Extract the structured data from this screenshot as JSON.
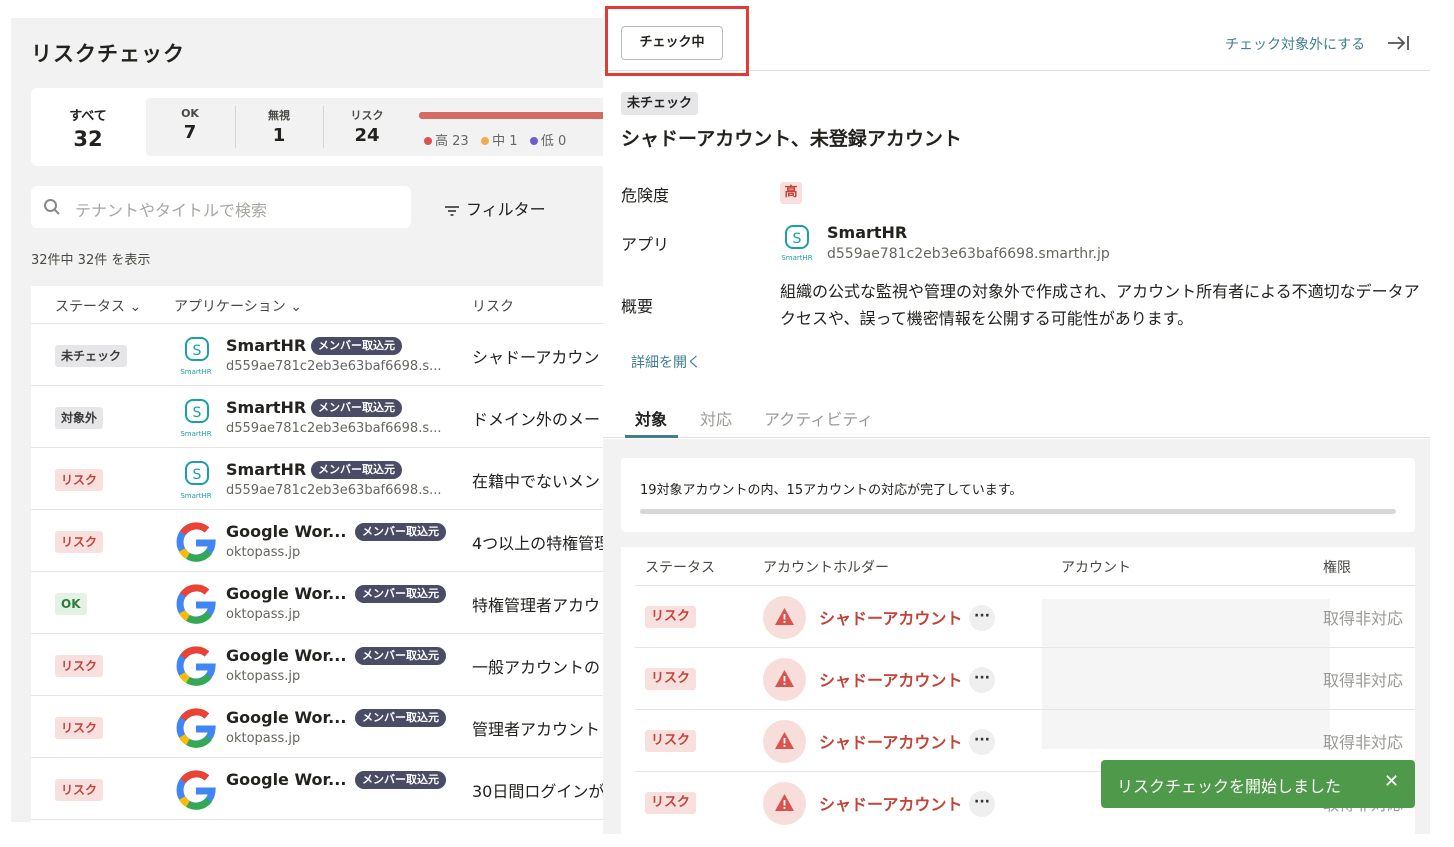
{
  "left": {
    "title": "リスクチェック",
    "summary": {
      "all": {
        "label": "すべて",
        "value": "32"
      },
      "ok": {
        "label": "OK",
        "value": "7"
      },
      "ignore": {
        "label": "無視",
        "value": "1"
      },
      "risk": {
        "label": "リスク",
        "value": "24"
      },
      "levels": [
        {
          "label": "高 23",
          "color": "#d9534f"
        },
        {
          "label": "中 1",
          "color": "#f0ad4e"
        },
        {
          "label": "低 0",
          "color": "#6f5bd3"
        }
      ]
    },
    "search_placeholder": "テナントやタイトルで検索",
    "filter_label": "フィルター",
    "count_text": "32件中 32件 を表示",
    "columns": {
      "status": "ステータス",
      "application": "アプリケーション",
      "risk": "リスク"
    },
    "rows": [
      {
        "status": "未チェック",
        "kind": "gray",
        "app": "SmartHR",
        "icon": "smarthr-icon",
        "tag": "メンバー取込元",
        "sub": "d559ae781c2eb3e63baf6698.s...",
        "risk": "シャドーアカウン"
      },
      {
        "status": "対象外",
        "kind": "gray",
        "app": "SmartHR",
        "icon": "smarthr-icon",
        "tag": "メンバー取込元",
        "sub": "d559ae781c2eb3e63baf6698.s...",
        "risk": "ドメイン外のメー"
      },
      {
        "status": "リスク",
        "kind": "red",
        "app": "SmartHR",
        "icon": "smarthr-icon",
        "tag": "メンバー取込元",
        "sub": "d559ae781c2eb3e63baf6698.s...",
        "risk": "在籍中でないメン"
      },
      {
        "status": "リスク",
        "kind": "red",
        "app": "Google Wor...",
        "icon": "google-icon",
        "tag": "メンバー取込元",
        "sub": "oktopass.jp",
        "risk": "4つ以上の特権管理"
      },
      {
        "status": "OK",
        "kind": "green",
        "app": "Google Wor...",
        "icon": "google-icon",
        "tag": "メンバー取込元",
        "sub": "oktopass.jp",
        "risk": "特権管理者アカウ"
      },
      {
        "status": "リスク",
        "kind": "red",
        "app": "Google Wor...",
        "icon": "google-icon",
        "tag": "メンバー取込元",
        "sub": "oktopass.jp",
        "risk": "一般アカウントの"
      },
      {
        "status": "リスク",
        "kind": "red",
        "app": "Google Wor...",
        "icon": "google-icon",
        "tag": "メンバー取込元",
        "sub": "oktopass.jp",
        "risk": "管理者アカウント"
      },
      {
        "status": "リスク",
        "kind": "red",
        "app": "Google Wor...",
        "icon": "google-icon",
        "tag": "メンバー取込元",
        "sub": "",
        "risk": "30日間ログインが"
      }
    ]
  },
  "detail": {
    "check_button": "チェック中",
    "exclude_link": "チェック対象外にする",
    "status_tag": "未チェック",
    "title": "シャドーアカウント、未登録アカウント",
    "severity_label": "危険度",
    "severity_value": "高",
    "app_label": "アプリ",
    "app_name": "SmartHR",
    "app_domain": "d559ae781c2eb3e63baf6698.smarthr.jp",
    "overview_label": "概要",
    "overview_text": "組織の公式な監視や管理の対象外で作成され、アカウント所有者による不適切なデータアクセスや、誤って機密情報を公開する可能性があります。",
    "detail_link": "詳細を開く",
    "tabs": [
      "対象",
      "対応",
      "アクティビティ"
    ],
    "progress_text": "19対象アカウントの内、15アカウントの対応が完了しています。",
    "progress": {
      "done": 15,
      "total": 19
    },
    "columns": {
      "status": "ステータス",
      "holder": "アカウントホルダー",
      "account": "アカウント",
      "permission": "権限"
    },
    "rows": [
      {
        "status": "リスク",
        "holder": "シャドーアカウント",
        "permission": "取得非対応"
      },
      {
        "status": "リスク",
        "holder": "シャドーアカウント",
        "permission": "取得非対応"
      },
      {
        "status": "リスク",
        "holder": "シャドーアカウント",
        "permission": "取得非対応"
      },
      {
        "status": "リスク",
        "holder": "シャドーアカウント",
        "permission": "取得非対応"
      }
    ]
  },
  "toast": {
    "message": "リスクチェックを開始しました",
    "close": "✕",
    "color": "#4e9a4a"
  }
}
